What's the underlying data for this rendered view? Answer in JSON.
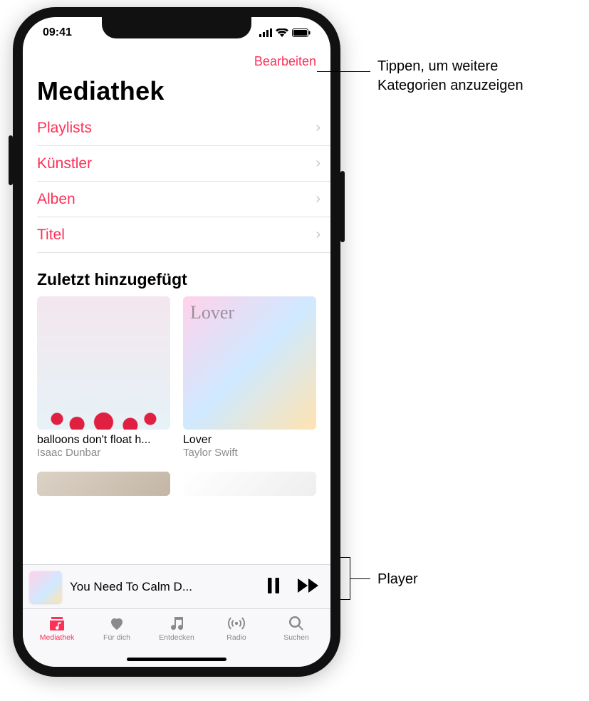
{
  "status": {
    "time": "09:41"
  },
  "nav": {
    "edit_label": "Bearbeiten"
  },
  "page": {
    "title": "Mediathek"
  },
  "categories": [
    {
      "label": "Playlists"
    },
    {
      "label": "Künstler"
    },
    {
      "label": "Alben"
    },
    {
      "label": "Titel"
    }
  ],
  "recent": {
    "header": "Zuletzt hinzugefügt",
    "items": [
      {
        "title": "balloons don't float h...",
        "artist": "Isaac Dunbar"
      },
      {
        "title": "Lover",
        "artist": "Taylor Swift"
      }
    ]
  },
  "player": {
    "now_playing": "You Need To Calm D..."
  },
  "tabs": [
    {
      "label": "Mediathek"
    },
    {
      "label": "Für dich"
    },
    {
      "label": "Entdecken"
    },
    {
      "label": "Radio"
    },
    {
      "label": "Suchen"
    }
  ],
  "callouts": {
    "edit": "Tippen, um weitere\nKategorien anzuzeigen",
    "player": "Player"
  }
}
